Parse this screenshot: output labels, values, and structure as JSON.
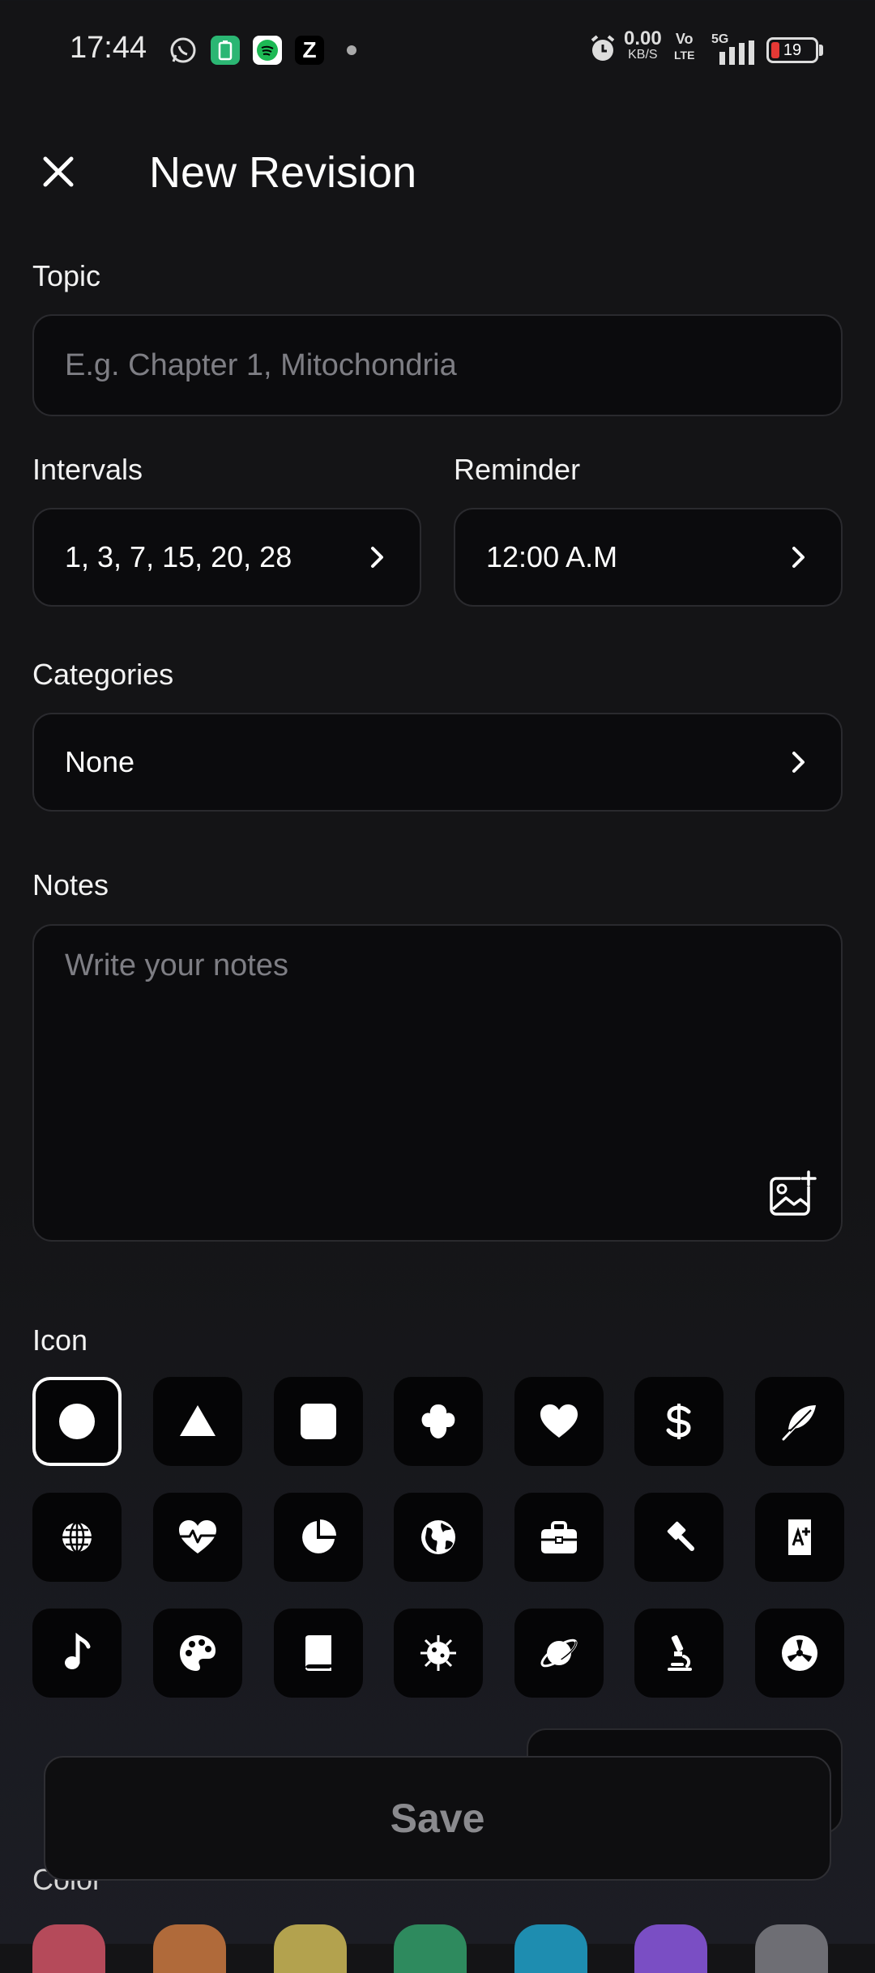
{
  "status_bar": {
    "time": "17:44",
    "net_speed_value": "0.00",
    "net_speed_unit": "KB/S",
    "volte_top": "Vo",
    "volte_bottom": "LTE",
    "network": "5G",
    "battery": "19",
    "battery_level_percent": 19,
    "battery_color": "#e53935"
  },
  "header": {
    "title": "New Revision"
  },
  "topic": {
    "label": "Topic",
    "placeholder": "E.g. Chapter 1, Mitochondria"
  },
  "intervals": {
    "label": "Intervals",
    "value": "1, 3, 7, 15, 20, 28"
  },
  "reminder": {
    "label": "Reminder",
    "value": "12:00 A.M"
  },
  "categories": {
    "label": "Categories",
    "value": "None"
  },
  "notes": {
    "label": "Notes",
    "placeholder": "Write your notes"
  },
  "icon_section": {
    "label": "Icon",
    "selected": "circle-icon",
    "rows": [
      [
        "circle-icon",
        "triangle-icon",
        "square-icon",
        "flower-icon",
        "heart-icon",
        "dollar-icon",
        "feather-icon"
      ],
      [
        "globe-icon",
        "heartbeat-icon",
        "pie-chart-icon",
        "earth-icon",
        "briefcase-icon",
        "gavel-icon",
        "translate-icon"
      ],
      [
        "music-note-icon",
        "palette-icon",
        "book-icon",
        "virus-icon",
        "planet-icon",
        "microscope-icon",
        "radiation-icon"
      ]
    ]
  },
  "save_button": {
    "label": "Save"
  },
  "color_section": {
    "label": "Color",
    "swatches": [
      "#b54a5a",
      "#b06a3a",
      "#b3a24e",
      "#2e8a5e",
      "#1e8db0",
      "#7a4ec4",
      "#6e6e74"
    ]
  }
}
